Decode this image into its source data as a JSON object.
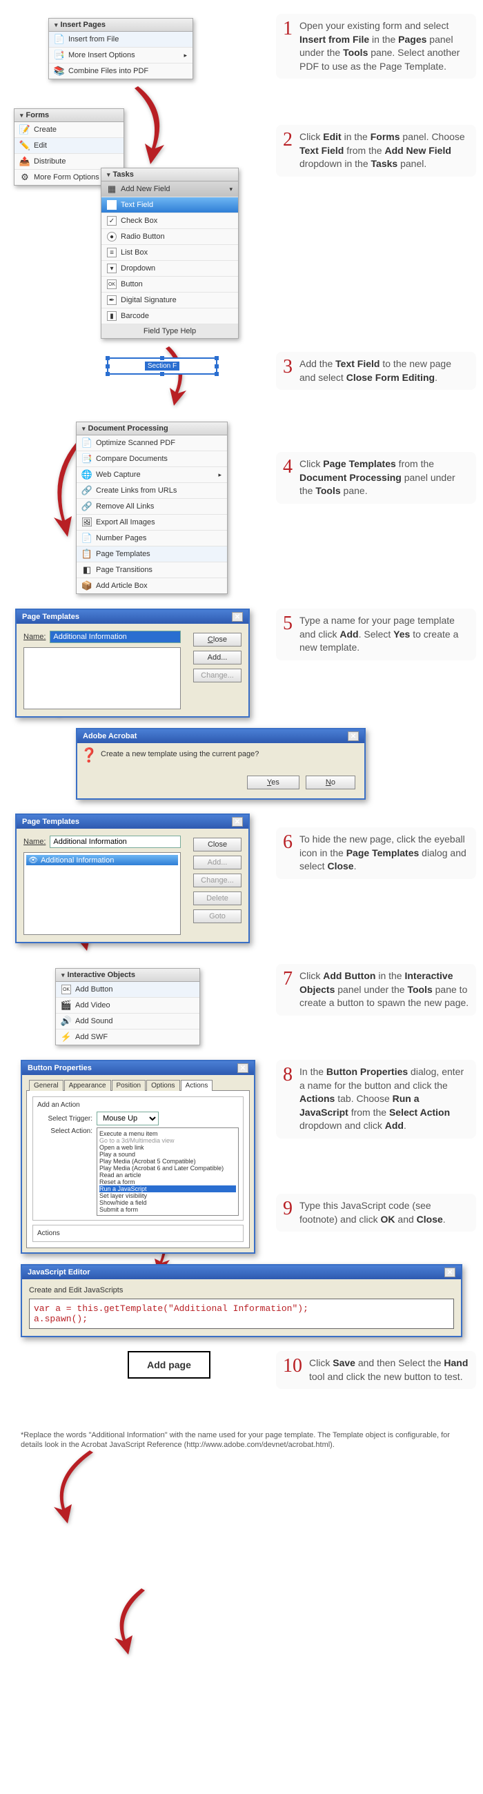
{
  "step1": {
    "num": "1",
    "text1": "Open your existing form and select ",
    "b1": "Insert from File",
    "text2": " in the ",
    "b2": "Pages",
    "text3": " panel under the ",
    "b3": "Tools",
    "text4": " pane. Select another PDF to use as the Page Template.",
    "panel_title": "Insert Pages",
    "items": [
      "Insert from File",
      "More Insert Options",
      "Combine Files into PDF"
    ]
  },
  "step2": {
    "num": "2",
    "text1": "Click ",
    "b1": "Edit",
    "text2": " in the ",
    "b2": "Forms",
    "text3": " panel. Choose ",
    "b3": "Text Field",
    "text4": " from the ",
    "b4": "Add New Field",
    "text5": " dropdown in the ",
    "b5": "Tasks",
    "text6": " panel.",
    "forms_title": "Forms",
    "forms_items": [
      "Create",
      "Edit",
      "Distribute",
      "More Form Options"
    ],
    "tasks_title": "Tasks",
    "task_head": "Add New Field",
    "task_items": [
      "Text Field",
      "Check Box",
      "Radio Button",
      "List Box",
      "Dropdown",
      "Button",
      "Digital Signature",
      "Barcode"
    ],
    "task_foot": "Field Type Help"
  },
  "step3": {
    "num": "3",
    "text1": "Add the ",
    "b1": "Text Field",
    "text2": " to the new page and select ",
    "b2": "Close Form Editing",
    "text3": ".",
    "field_label": "Section F"
  },
  "step4": {
    "num": "4",
    "text1": "Click ",
    "b1": "Page Templates",
    "text2": " from the ",
    "b2": "Document Processing",
    "text3": " panel under the ",
    "b3": "Tools",
    "text4": " pane.",
    "panel_title": "Document Processing",
    "items": [
      "Optimize Scanned PDF",
      "Compare Documents",
      "Web Capture",
      "Create Links from URLs",
      "Remove All Links",
      "Export All Images",
      "Number Pages",
      "Page Templates",
      "Page Transitions",
      "Add Article Box"
    ]
  },
  "step5": {
    "num": "5",
    "text1": "Type a name for your page template and click ",
    "b1": "Add",
    "text2": ". Select ",
    "b2": "Yes",
    "text3": " to create a new template.",
    "dlg_title": "Page Templates",
    "name_label": "Name:",
    "name_value": "Additional Information",
    "btns": {
      "close": "Close",
      "add": "Add...",
      "change": "Change..."
    },
    "confirm_title": "Adobe Acrobat",
    "confirm_msg": "Create a new template using the current page?",
    "yes": "Yes",
    "no": "No"
  },
  "step6": {
    "num": "6",
    "text1": "To hide the new page, click the eyeball icon in the ",
    "b1": "Page Templates",
    "text2": " dialog and select ",
    "b2": "Close",
    "text3": ".",
    "dlg_title": "Page Templates",
    "name_label": "Name:",
    "name_value": "Additional Information",
    "list_item": "Additional Information",
    "btns": {
      "close": "Close",
      "add": "Add...",
      "change": "Change...",
      "delete": "Delete",
      "goto": "Goto"
    }
  },
  "step7": {
    "num": "7",
    "text1": "Click ",
    "b1": "Add Button",
    "text2": " in the ",
    "b2": "Interactive Objects",
    "text3": " panel under the ",
    "b3": "Tools",
    "text4": " pane to create a button to spawn the new page.",
    "panel_title": "Interactive Objects",
    "items": [
      "Add Button",
      "Add Video",
      "Add Sound",
      "Add SWF"
    ]
  },
  "step8": {
    "num": "8",
    "text1": "In the ",
    "b1": "Button Properties",
    "text2": " dialog, enter a name for the button and click the ",
    "b2": "Actions",
    "text3": " tab. Choose ",
    "b3": "Run a JavaScript",
    "text4": " from the ",
    "b4": "Select Action",
    "text5": " dropdown and click ",
    "b5": "Add",
    "text6": ".",
    "dlg_title": "Button Properties",
    "tabs": [
      "General",
      "Appearance",
      "Position",
      "Options",
      "Actions"
    ],
    "add_action": "Add an Action",
    "sel_trigger_lbl": "Select Trigger:",
    "sel_trigger_val": "Mouse Up",
    "sel_action_lbl": "Select Action:",
    "actions_lbl": "Actions",
    "action_list": [
      "Execute a menu item",
      "Go to a 3d/Multimedia view",
      "Open a web link",
      "Play a sound",
      "Play Media (Acrobat 5 Compatible)",
      "Play Media (Acrobat 6 and Later Compatible)",
      "Read an article",
      "Reset a form",
      "Run a JavaScript",
      "Set layer visibility",
      "Show/hide a field",
      "Submit a form"
    ]
  },
  "step9": {
    "num": "9",
    "text1": "Type this JavaScript code (see footnote) and click ",
    "b1": "OK",
    "text2": " and ",
    "b2": "Close",
    "text3": ".",
    "dlg_title": "JavaScript Editor",
    "sub": "Create and Edit JavaScripts",
    "code_l1": "var a = this.getTemplate(\"Additional Information\");",
    "code_l2": "a.spawn();"
  },
  "step10": {
    "num": "10",
    "text1": "Click ",
    "b1": "Save",
    "text2": " and then Select the ",
    "b2": "Hand",
    "text3": " tool and click the new button to test.",
    "btn_label": "Add page"
  },
  "footnote": "*Replace the words \"Additional Information\" with the name used for your page template. The Template object is configurable, for details look in the Acrobat JavaScript Reference (http://www.adobe.com/devnet/acrobat.html)."
}
